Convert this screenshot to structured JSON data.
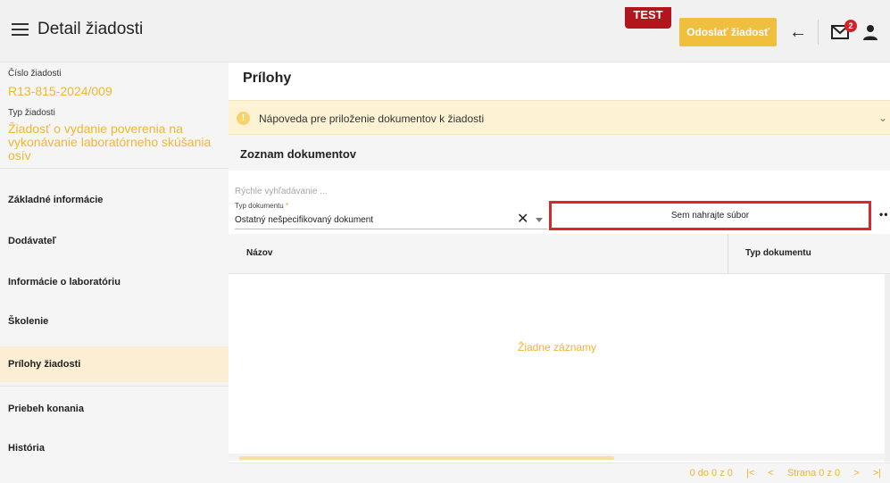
{
  "header": {
    "title": "Detail žiadosti",
    "env_badge": "TEST",
    "send_label": "Odoslať žiadosť",
    "back_icon": "←",
    "mail_badge_count": "2"
  },
  "sidebar": {
    "number_label": "Číslo žiadosti",
    "number_value": "R13-815-2024/009",
    "type_label": "Typ žiadosti",
    "type_value": "Žiadosť o vydanie poverenia na vykonávanie laboratórneho skúšania osív",
    "items": [
      {
        "label": "Základné informácie"
      },
      {
        "label": "Dodávateľ"
      },
      {
        "label": "Informácie o laboratóriu"
      },
      {
        "label": "Školenie"
      },
      {
        "label": "Prílohy žiadosti"
      },
      {
        "label": "Priebeh konania"
      },
      {
        "label": "História"
      }
    ]
  },
  "main": {
    "title": "Prílohy",
    "help_text": "Nápoveda pre priloženie dokumentov k žiadosti",
    "help_chevron": "⌄",
    "section_title": "Zoznam dokumentov",
    "search_placeholder": "Rýchle vyhľadávanie ...",
    "doc_type_label": "Typ dokumentu",
    "doc_type_required": "*",
    "doc_type_value": "Ostatný nešpecifikovaný dokument",
    "clear_icon": "✕",
    "upload_label": "Sem nahrajte súbor",
    "more_icon": "••",
    "table": {
      "columns": [
        "Názov",
        "Typ dokumentu"
      ],
      "empty_text": "Žiadne záznamy"
    },
    "pager": {
      "range": "0 do 0 z 0",
      "first": "|<",
      "prev": "<",
      "page_text": "Strana 0 z 0",
      "next": ">",
      "last": ">|"
    }
  },
  "colors": {
    "accent": "#f0bf3e",
    "badge_red": "#b3151c",
    "highlight_border": "#e0242b",
    "active_nav_bg": "#fbeed2"
  },
  "icons": {
    "menu": "hamburger-menu-icon",
    "back": "arrow-left-icon",
    "mail": "mail-icon",
    "user": "user-icon",
    "info": "info-icon",
    "clear": "close-icon",
    "caret": "chevron-down-icon",
    "more": "more-horizontal-icon"
  }
}
